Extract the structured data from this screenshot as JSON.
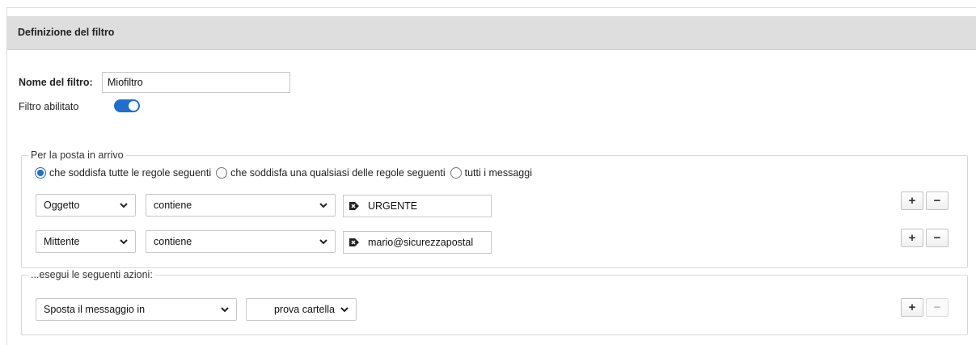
{
  "header": {
    "title": "Definizione del filtro"
  },
  "filter": {
    "name_label": "Nome del filtro:",
    "name_value": "Miofiltro",
    "enabled_label": "Filtro abilitato",
    "enabled": true
  },
  "incoming": {
    "legend": "Per la posta in arrivo",
    "match_options": [
      {
        "label": "che soddisfa tutte le regole seguenti",
        "checked": true
      },
      {
        "label": "che soddisfa una qualsiasi delle regole seguenti",
        "checked": false
      },
      {
        "label": "tutti i messaggi",
        "checked": false
      }
    ],
    "rules": [
      {
        "field": "Oggetto",
        "operator": "contiene",
        "value": "URGENTE",
        "icon": "tag-icon"
      },
      {
        "field": "Mittente",
        "operator": "contiene",
        "value": "mario@sicurezzapostal",
        "icon": "tag-icon"
      }
    ]
  },
  "actions": {
    "legend": "...esegui le seguenti azioni:",
    "items": [
      {
        "action": "Sposta il messaggio in",
        "target": "prova cartella"
      }
    ]
  },
  "buttons": {
    "add": "+",
    "remove": "−"
  },
  "colors": {
    "accent": "#1f6fd0",
    "header_bg": "#dedede"
  }
}
